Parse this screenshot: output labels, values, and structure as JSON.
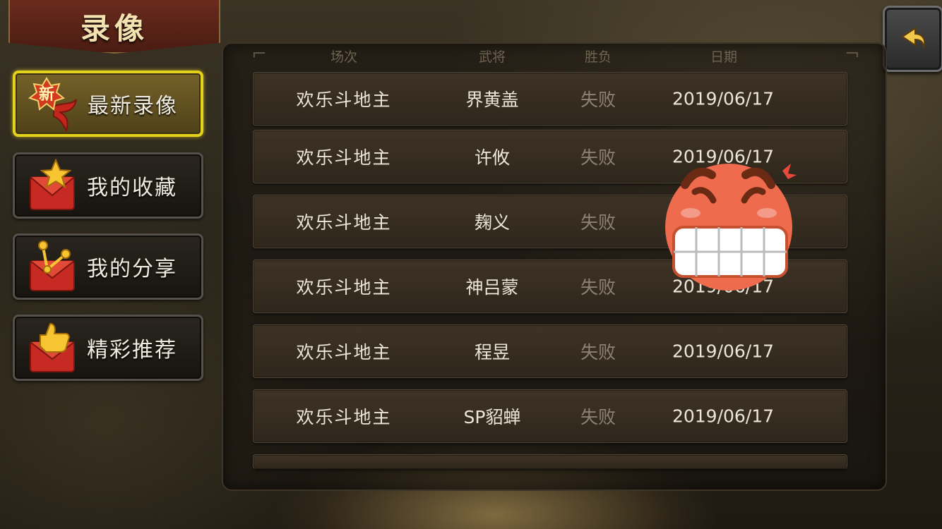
{
  "title": "录像",
  "back_icon": "back-arrow-icon",
  "menu": [
    {
      "label": "最新录像",
      "icon": "new-badge-icon",
      "active": true
    },
    {
      "label": "我的收藏",
      "icon": "star-envelope-icon",
      "active": false
    },
    {
      "label": "我的分享",
      "icon": "share-envelope-icon",
      "active": false
    },
    {
      "label": "精彩推荐",
      "icon": "thumbs-up-envelope-icon",
      "active": false
    }
  ],
  "new_badge_text": "新",
  "table": {
    "headers": {
      "mode": "场次",
      "general": "武将",
      "result": "胜负",
      "date": "日期"
    },
    "rows": [
      {
        "mode": "欢乐斗地主",
        "general": "界黄盖",
        "result": "失败",
        "date": "2019/06/17"
      },
      {
        "mode": "欢乐斗地主",
        "general": "许攸",
        "result": "失败",
        "date": "2019/06/17"
      },
      {
        "mode": "欢乐斗地主",
        "general": "麹义",
        "result": "失败",
        "date": ""
      },
      {
        "mode": "欢乐斗地主",
        "general": "神吕蒙",
        "result": "失败",
        "date": "2019/06/17"
      },
      {
        "mode": "欢乐斗地主",
        "general": "程昱",
        "result": "失败",
        "date": "2019/06/17"
      },
      {
        "mode": "欢乐斗地主",
        "general": "SP貂蝉",
        "result": "失败",
        "date": "2019/06/17"
      }
    ]
  },
  "colors": {
    "active_border": "#e3d21b",
    "result_text": "#8c8272",
    "title_text": "#f3e2b0"
  },
  "sticker_icon": "angry-face-emoji-icon"
}
